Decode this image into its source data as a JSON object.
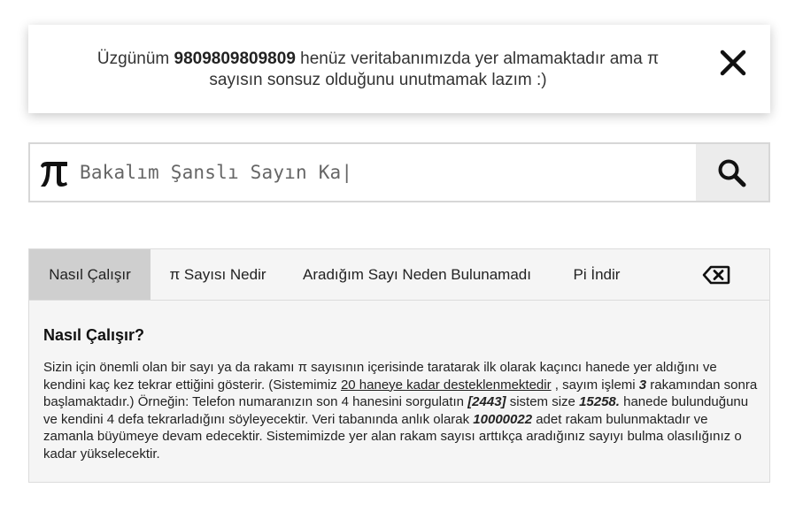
{
  "alert": {
    "text_before": "Üzgünüm ",
    "number": "9809809809809",
    "text_after": " henüz veritabanımızda yer almamaktadır ama π sayısın sonsuz olduğunu unutmamak lazım :)",
    "close_icon": "close-icon"
  },
  "search": {
    "value": "Bakalım Şanslı Sayın Ka|",
    "prefix_icon": "pi-icon",
    "button_icon": "search-icon"
  },
  "tabs": [
    {
      "label": "Nasıl Çalışır",
      "active": true
    },
    {
      "label": "π Sayısı Nedir",
      "active": false
    },
    {
      "label": "Aradığım Sayı Neden Bulunamadı",
      "active": false
    },
    {
      "label": "Pi İndir",
      "active": false
    }
  ],
  "tab_clear_icon": "backspace-icon",
  "content": {
    "title": "Nasıl Çalışır?",
    "p1": "Sizin için önemli olan bir sayı ya da rakamı π sayısının içerisinde taratarak ilk olarak kaçıncı hanede yer aldığını ve kendini kaç kez tekrar ettiğini gösterir. (Sistemimiz ",
    "link": "20 haneye kadar desteklenmektedir",
    "p2": " , sayım işlemi ",
    "n1": "3",
    "p3": " rakamından sonra başlamaktadır.) Örneğin: Telefon numaranızın son 4 hanesini sorgulatın ",
    "n2": "[2443]",
    "p4": " sistem size ",
    "n3": "15258.",
    "p5": " hanede bulunduğunu ve kendini 4 defa tekrarladığını söyleyecektir. Veri tabanında anlık olarak ",
    "n4": "10000022",
    "p6": " adet rakam bulunmaktadır ve zamanla büyümeye devam edecektir. Sistemimizde yer alan rakam sayısı arttıkça aradığınız sayıyı bulma olasılığınız o kadar yükselecektir."
  },
  "colors": {
    "active_tab": "#cfcfcf",
    "panel_bg": "#f5f5f5",
    "search_button_bg": "#ececec",
    "border": "#d7d7d7"
  }
}
